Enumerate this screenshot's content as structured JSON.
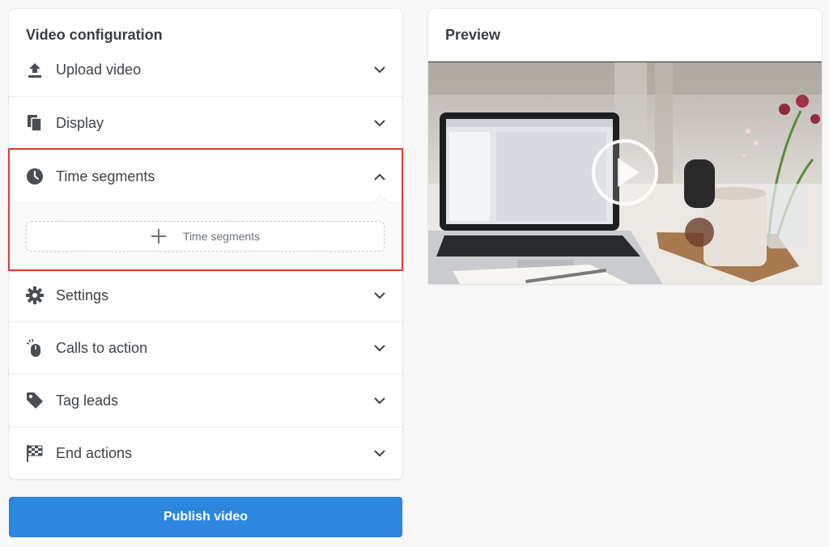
{
  "config": {
    "title": "Video configuration",
    "sections": [
      {
        "label": "Upload video",
        "icon": "upload-icon",
        "expanded": false
      },
      {
        "label": "Display",
        "icon": "copy-icon",
        "expanded": false
      },
      {
        "label": "Time segments",
        "icon": "clock-icon",
        "expanded": true
      },
      {
        "label": "Settings",
        "icon": "gear-icon",
        "expanded": false
      },
      {
        "label": "Calls to action",
        "icon": "mouse-icon",
        "expanded": false
      },
      {
        "label": "Tag leads",
        "icon": "tag-icon",
        "expanded": false
      },
      {
        "label": "End actions",
        "icon": "checkered-flag-icon",
        "expanded": false
      }
    ],
    "time_segments": {
      "add_label": "Time segments"
    }
  },
  "publish": {
    "label": "Publish video"
  },
  "preview": {
    "title": "Preview"
  },
  "colors": {
    "accent": "#2d87df",
    "highlight": "#e53935"
  }
}
